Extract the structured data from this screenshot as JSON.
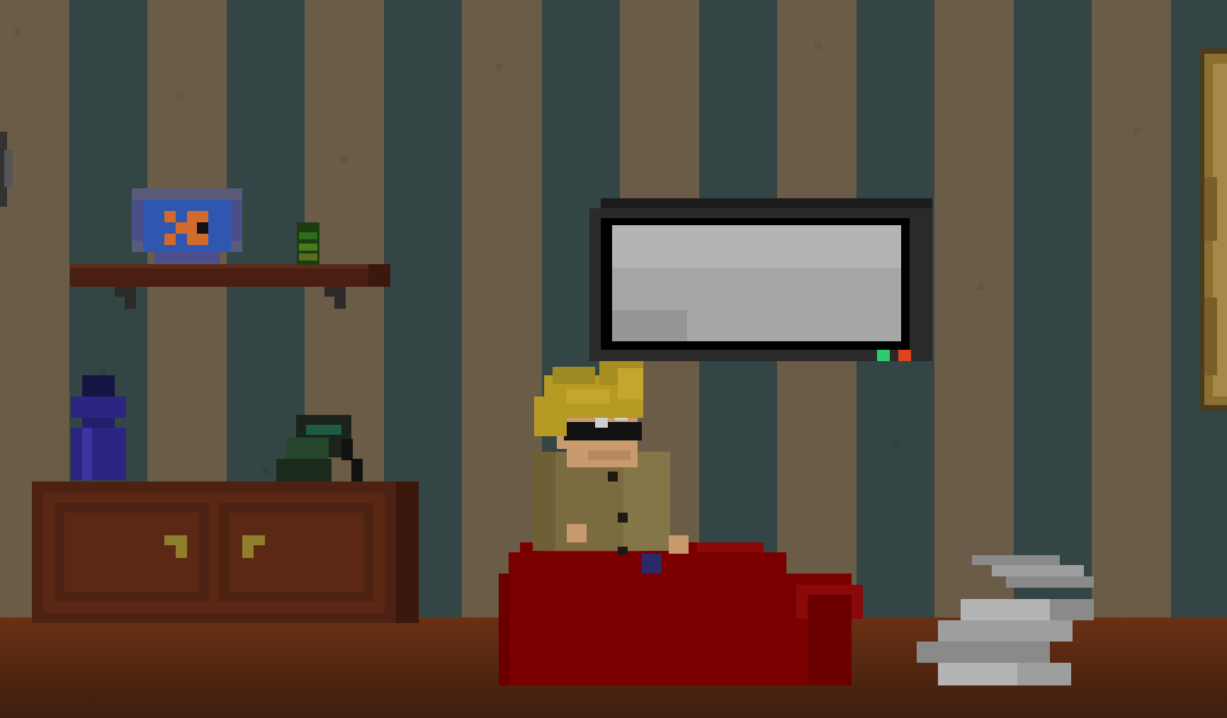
{
  "scene": {
    "name": "living-room",
    "palette": {
      "wall_stripe_light": "#6b5c48",
      "wall_stripe_dark": "#344545",
      "floor_top": "#6b3014",
      "floor_bottom": "#3c1f0d",
      "shelf_wood": "#4a1f12",
      "dresser_wood": "#4e2212",
      "dresser_panel": "#5a2715",
      "drawer_handle": "#8f7f2c",
      "tv_frame": "#1c1c1c",
      "tv_screen": "#a6a6a6",
      "tv_led_on": "#2ecc71",
      "tv_led_power": "#e0441b",
      "beanbag": "#7a0000",
      "player_hair": "#b59a24",
      "player_skin": "#c99a6d",
      "player_shirt": "#7a6b40",
      "paper_stack": "#9e9e9e",
      "vase": "#2b2680",
      "fishbowl": "#2f57b0",
      "goldfish": "#d26a2c",
      "frame_gold": "#8a6f31"
    },
    "objects": [
      {
        "id": "wall-shelf",
        "type": "furniture"
      },
      {
        "id": "fish-bowl",
        "type": "decoration"
      },
      {
        "id": "green-bottle",
        "type": "item"
      },
      {
        "id": "blue-vase",
        "type": "decoration"
      },
      {
        "id": "dresser",
        "type": "furniture",
        "drawers": 2
      },
      {
        "id": "telephone",
        "type": "item"
      },
      {
        "id": "wall-tv",
        "type": "appliance"
      },
      {
        "id": "player-character",
        "type": "character"
      },
      {
        "id": "beanbag",
        "type": "furniture"
      },
      {
        "id": "paper-stack",
        "type": "item"
      },
      {
        "id": "picture-frame",
        "type": "decoration"
      },
      {
        "id": "wall-clock-edge",
        "type": "decoration"
      }
    ]
  }
}
